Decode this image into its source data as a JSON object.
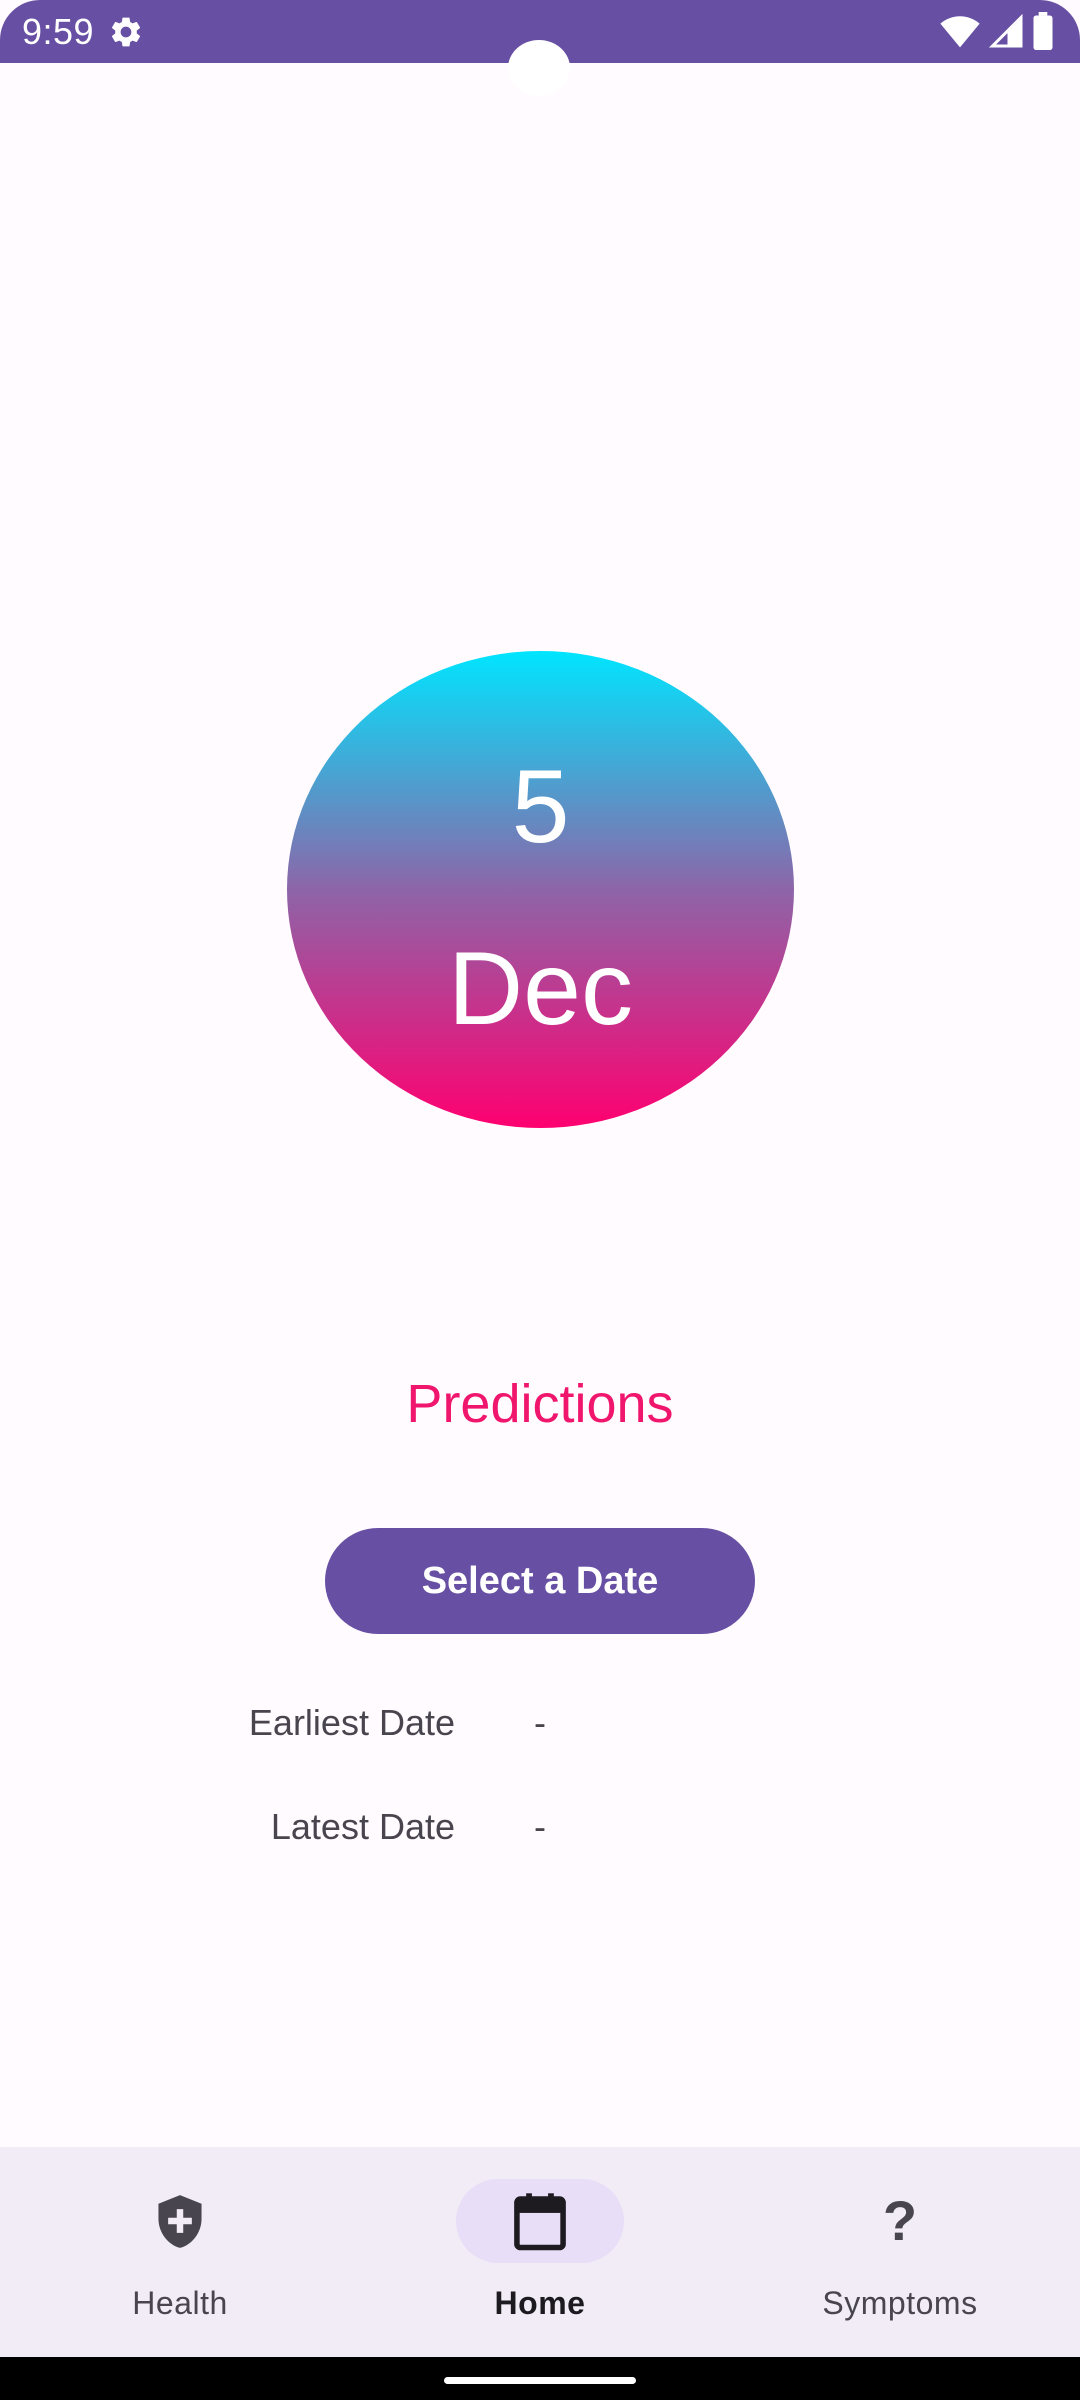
{
  "status_bar": {
    "time": "9:59",
    "icons": [
      "gear-icon",
      "wifi-icon",
      "cellular-icon",
      "battery-icon"
    ],
    "background": "#6750a4"
  },
  "date_display": {
    "day": "5",
    "month": "Dec",
    "gradient": [
      "#00e5ff",
      "#8d65a8",
      "#ff0070"
    ]
  },
  "predictions": {
    "title": "Predictions",
    "title_color": "#f0166d",
    "button_label": "Select a Date",
    "rows": [
      {
        "label": "Earliest Date",
        "value": "-"
      },
      {
        "label": "Latest Date",
        "value": "-"
      }
    ]
  },
  "bottom_nav": {
    "items": [
      {
        "label": "Health",
        "icon": "shield-plus-icon",
        "active": false
      },
      {
        "label": "Home",
        "icon": "calendar-icon",
        "active": true
      },
      {
        "label": "Symptoms",
        "icon": "question-mark-icon",
        "active": false
      }
    ]
  },
  "colors": {
    "accent": "#6750a4",
    "nav_background": "#f2ecf6",
    "active_indicator": "#e8def8"
  }
}
